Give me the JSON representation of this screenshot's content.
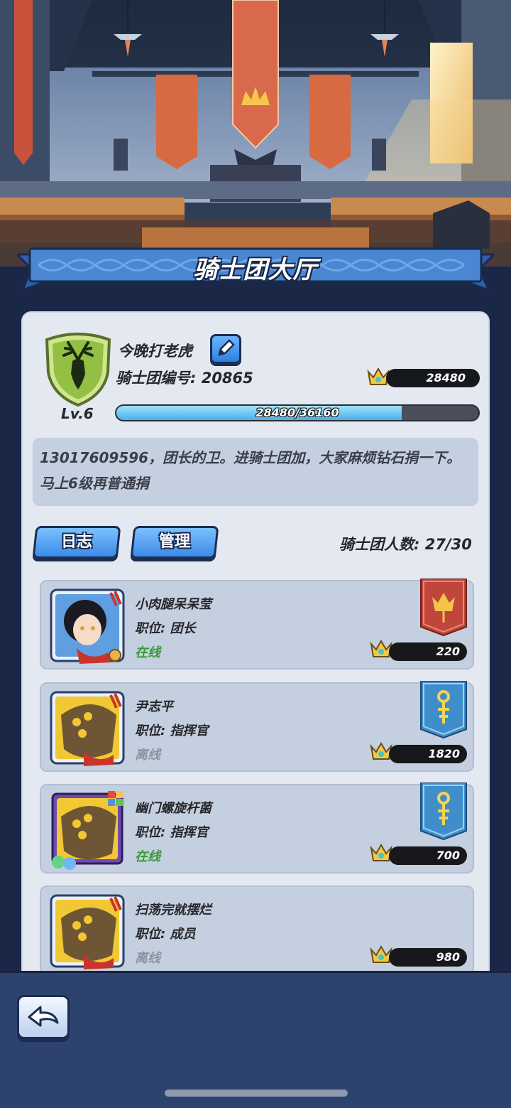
{
  "header": {
    "title": "骑士团大厅"
  },
  "guild": {
    "name": "今晚打老虎",
    "id_label": "骑士团编号: 20865",
    "trophies": "28480",
    "level": "Lv.6",
    "xp_text": "28480/36160",
    "xp_current": 28480,
    "xp_max": 36160,
    "notice": "13017609596，团长的卫。进骑士团加，大家麻烦钻石捐一下。马上6级再普通捐"
  },
  "tabs": {
    "log_label": "日志",
    "manage_label": "管理"
  },
  "member_count": "骑士团人数: 27/30",
  "members": [
    {
      "name": "小肉腿呆呆莹",
      "role": "职位: 团长",
      "status": "在线",
      "trophies": "220",
      "rank_icon": "crown-flag-icon"
    },
    {
      "name": "尹志平",
      "role": "职位: 指挥官",
      "status": "离线",
      "trophies": "1820",
      "rank_icon": "sword-flag-icon"
    },
    {
      "name": "幽门螺旋杆菌",
      "role": "职位: 指挥官",
      "status": "在线",
      "trophies": "700",
      "rank_icon": "sword-flag-icon"
    },
    {
      "name": "扫荡完就摆烂",
      "role": "职位: 成员",
      "status": "离线",
      "trophies": "980",
      "rank_icon": ""
    }
  ],
  "colors": {
    "online": "#3b9a3a",
    "offline": "#8d939e",
    "accent": "#3a8ae8",
    "banner_red": "#c0453a",
    "banner_blue": "#3f8ec9"
  }
}
